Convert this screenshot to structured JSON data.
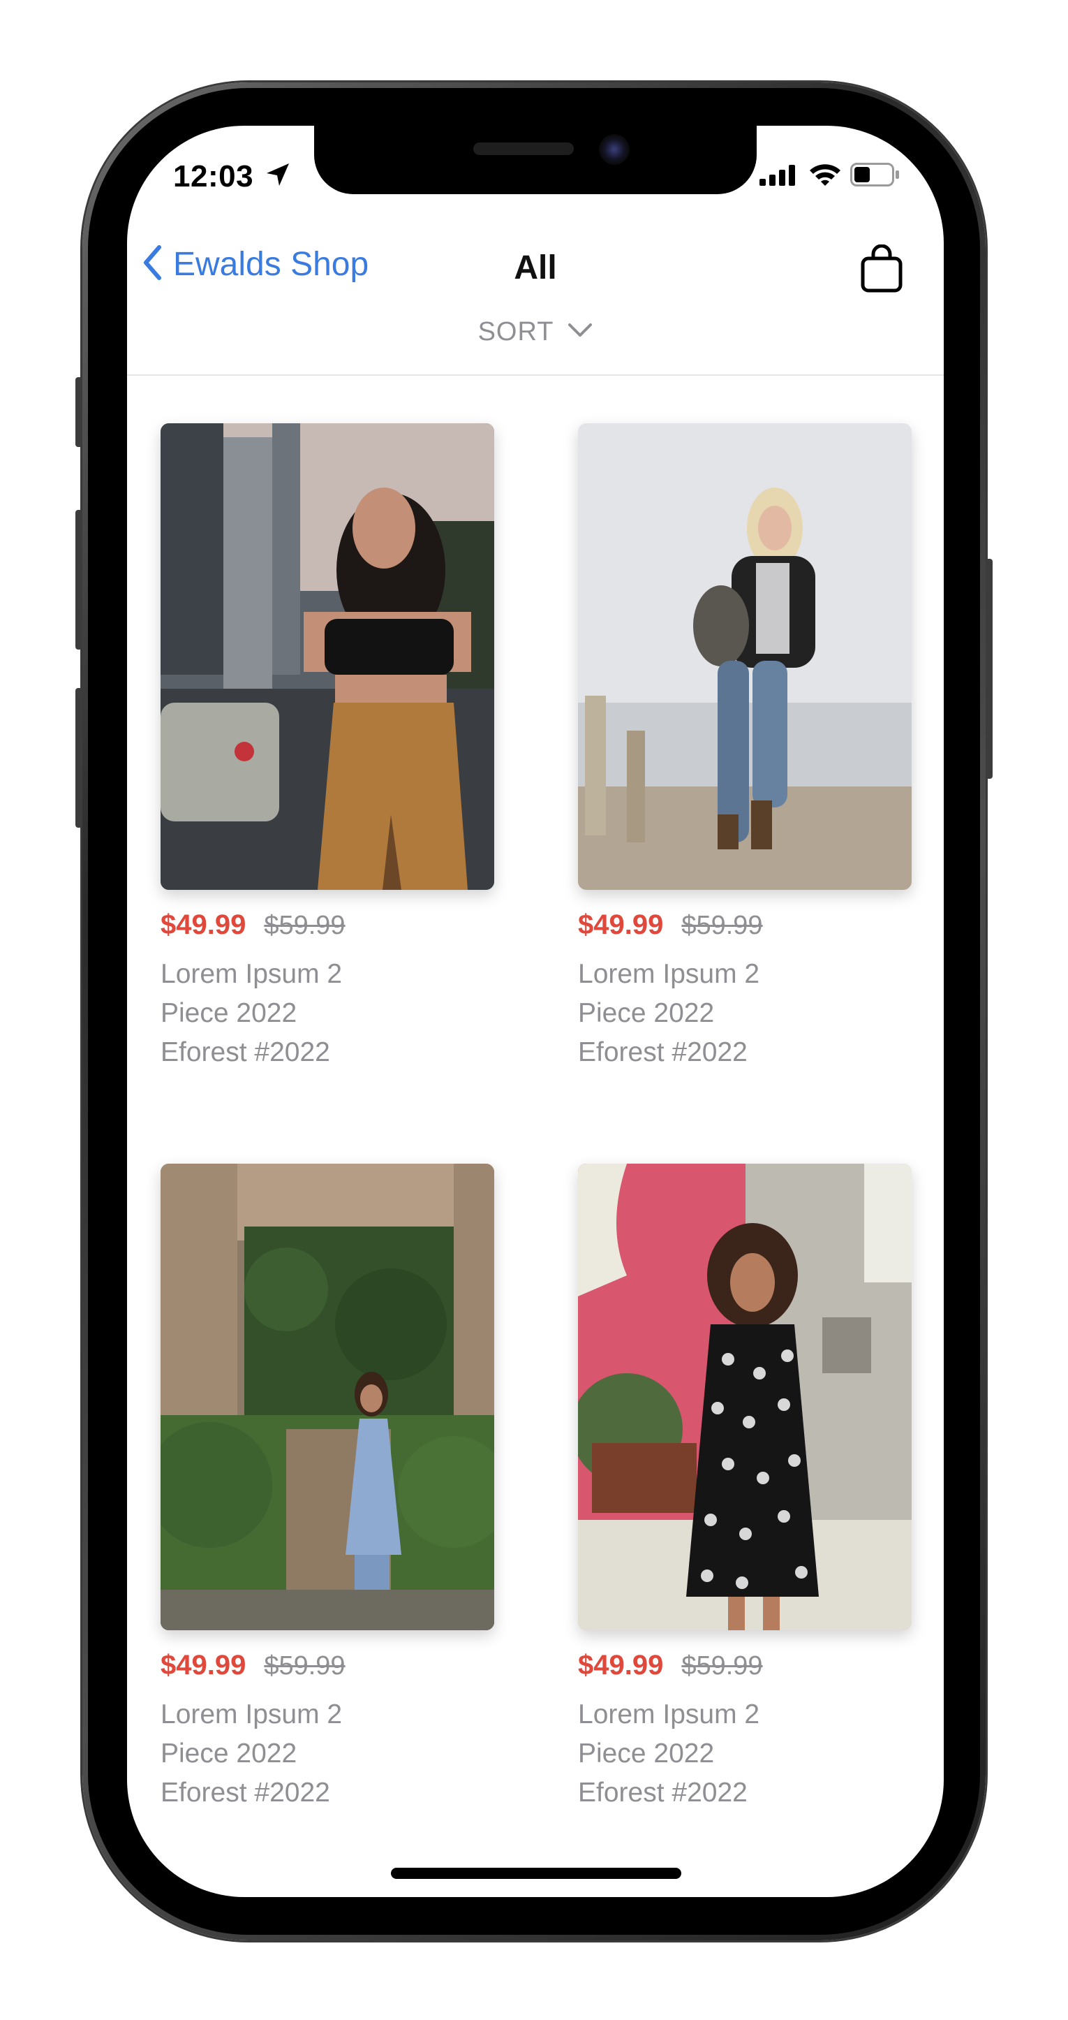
{
  "status_bar": {
    "time": "12:03",
    "icons": [
      "location-arrow-icon",
      "cellular-signal-icon",
      "wifi-icon",
      "battery-icon"
    ]
  },
  "nav": {
    "back_label": "Ewalds Shop",
    "title": "All",
    "cart_icon": "shopping-bag-icon",
    "back_icon": "chevron-left-icon"
  },
  "sort": {
    "label": "SORT",
    "icon": "chevron-down-icon"
  },
  "colors": {
    "accent": "#3a7be0",
    "sale_price": "#e0483c",
    "secondary_text": "#8e8e93"
  },
  "products": [
    {
      "sale_price": "$49.99",
      "original_price": "$59.99",
      "name_line1": "Lorem Ipsum 2",
      "name_line2": "Piece 2022",
      "name_line3": "Eforest #2022"
    },
    {
      "sale_price": "$49.99",
      "original_price": "$59.99",
      "name_line1": "Lorem Ipsum 2",
      "name_line2": "Piece 2022",
      "name_line3": "Eforest #2022"
    },
    {
      "sale_price": "$49.99",
      "original_price": "$59.99",
      "name_line1": "Lorem Ipsum 2",
      "name_line2": "Piece 2022",
      "name_line3": "Eforest #2022"
    },
    {
      "sale_price": "$49.99",
      "original_price": "$59.99",
      "name_line1": "Lorem Ipsum 2",
      "name_line2": "Piece 2022",
      "name_line3": "Eforest #2022"
    }
  ]
}
